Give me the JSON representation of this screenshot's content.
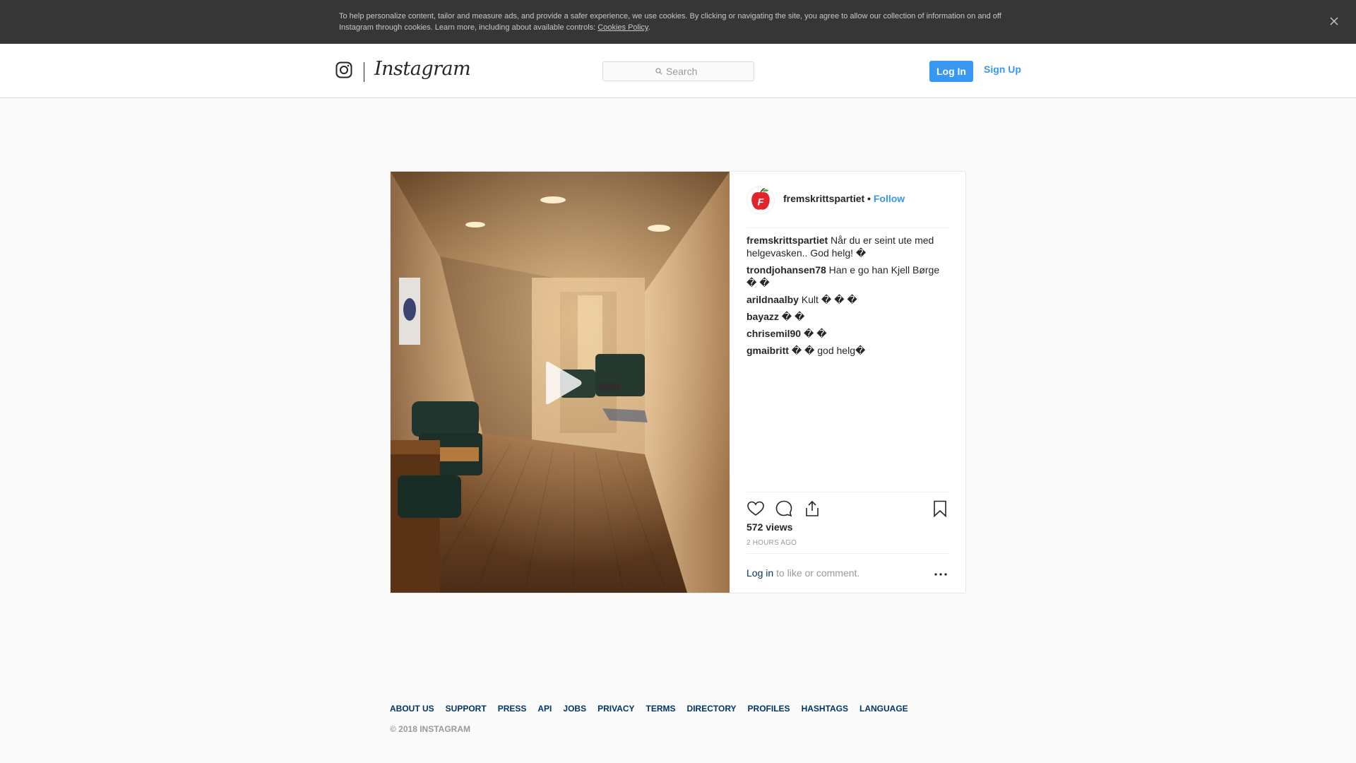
{
  "cookie": {
    "text": "To help personalize content, tailor and measure ads, and provide a safer experience, we use cookies. By clicking or navigating the site, you agree to allow our collection of information on and off Instagram through cookies. Learn more, including about available controls: ",
    "link": "Cookies Policy",
    "after": "."
  },
  "nav": {
    "wordmark": "Instagram",
    "search_placeholder": "Search",
    "login": "Log In",
    "signup": "Sign Up"
  },
  "post": {
    "username": "fremskrittspartiet",
    "separator": " • ",
    "follow": "Follow",
    "comments": [
      {
        "user": "fremskrittspartiet",
        "text": " Når du er seint ute med helgevasken.. God helg! �"
      },
      {
        "user": "trondjohansen78",
        "text": " Han e go han Kjell Børge � �"
      },
      {
        "user": "arildnaalby",
        "text": " Kult � � �"
      },
      {
        "user": "bayazz",
        "text": " � �"
      },
      {
        "user": "chrisemil90",
        "text": " � �"
      },
      {
        "user": "gmaibritt",
        "text": " � � god helg�"
      }
    ],
    "views": "572 views",
    "time": "2 hours ago",
    "login_link": "Log in",
    "login_rest": " to like or comment."
  },
  "icons": {
    "close": "close-icon",
    "logo": "instagram-logo-icon",
    "search": "search-icon",
    "play": "play-icon",
    "like": "heart-icon",
    "comment": "comment-icon",
    "share": "share-icon",
    "save": "bookmark-icon",
    "more": "more-icon"
  },
  "footer": {
    "links": [
      "ABOUT US",
      "SUPPORT",
      "PRESS",
      "API",
      "JOBS",
      "PRIVACY",
      "TERMS",
      "DIRECTORY",
      "PROFILES",
      "HASHTAGS",
      "LANGUAGE"
    ],
    "copyright": "© 2018 INSTAGRAM"
  },
  "colors": {
    "accent": "#3897f0",
    "link_dark": "#003569",
    "banner": "#363636"
  }
}
